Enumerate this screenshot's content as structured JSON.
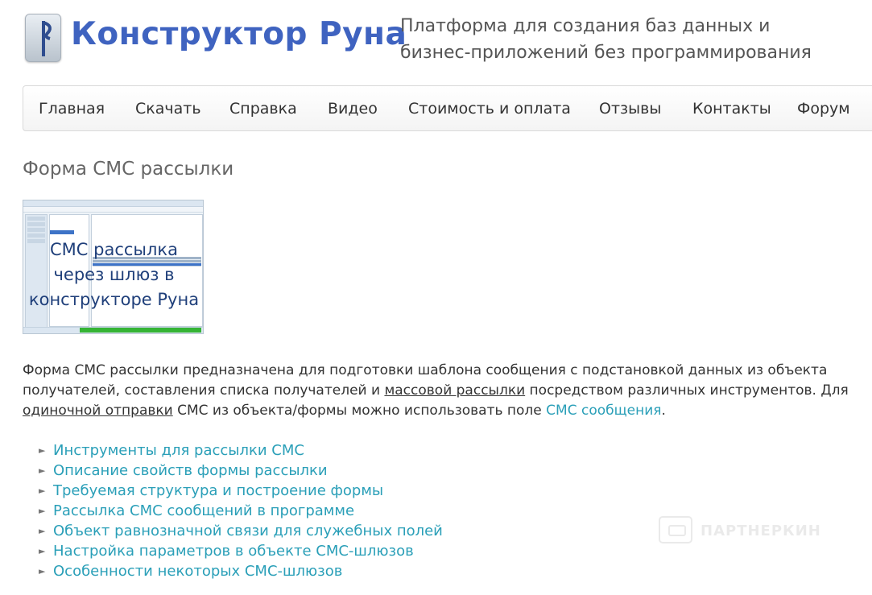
{
  "header": {
    "logo_text": "Конструктор Руна",
    "logo_symbol": "rune-logo-icon",
    "tagline_line1": "Платформа для создания баз данных и",
    "tagline_line2": "бизнес-приложений без программирования"
  },
  "nav": {
    "items": [
      "Главная",
      "Скачать",
      "Справка",
      "Видео",
      "Стоимость и оплата",
      "Отзывы",
      "Контакты",
      "Форум"
    ]
  },
  "page": {
    "title": "Форма СМС рассылки",
    "thumbnail_caption_line1": "СМС рассылка",
    "thumbnail_caption_line2": "через шлюз в",
    "thumbnail_caption_line3": "конструкторе Руна"
  },
  "description": {
    "part1": "Форма СМС рассылки предназначена для подготовки шаблона сообщения с подстановкой данных из объекта получателей, составления списка получателей и ",
    "link_mass": "массовой рассылки",
    "part2": " посредством различных инструментов. Для ",
    "link_single": "одиночной отправки",
    "part3": " СМС из объекта/формы можно использовать поле ",
    "link_field": "СМС сообщения",
    "part4": "."
  },
  "toc": [
    "Инструменты для рассылки СМС",
    "Описание свойств формы рассылки",
    "Требуемая структура и построение формы",
    "Рассылка СМС сообщений в программе",
    "Объект равнозначной связи для служебных полей",
    "Настройка параметров в объекте СМС-шлюзов",
    "Особенности некоторых СМС-шлюзов"
  ],
  "watermark": {
    "text": "ПАРТНЕРКИН"
  },
  "colors": {
    "brand_blue": "#3f63c0",
    "link": "#2a9fb8",
    "text": "#333333"
  }
}
